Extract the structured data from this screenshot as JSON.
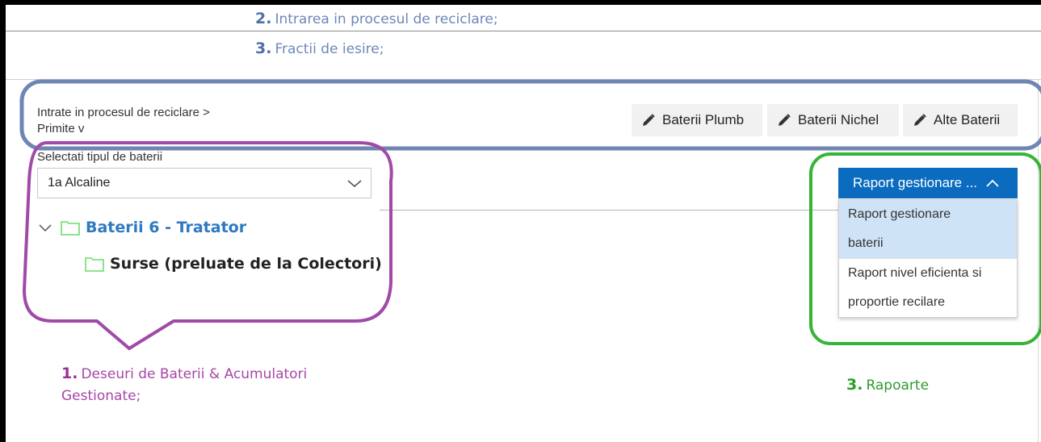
{
  "annotations": {
    "intrare": {
      "num": "2.",
      "text": "Intrarea in procesul de reciclare;"
    },
    "fractii": {
      "num": "3.",
      "text": "Fractii de iesire;"
    },
    "deseuri": {
      "num": "1.",
      "text": "Deseuri de Baterii & Acumulatori Gestionate;"
    },
    "rapoarte": {
      "num": "3.",
      "text": "Rapoarte"
    }
  },
  "breadcrumb": {
    "line1": "Intrate in procesul de reciclare  >",
    "line2": "Primite   v"
  },
  "toolbar": {
    "buttons": [
      {
        "label": "Baterii Plumb"
      },
      {
        "label": "Baterii Nichel"
      },
      {
        "label": "Alte Baterii"
      }
    ]
  },
  "battery_select": {
    "label": "Selectati tipul de baterii",
    "value": "1a Alcaline"
  },
  "tree": {
    "root": "Baterii 6 - Tratator",
    "child": "Surse (preluate de la Colectori)"
  },
  "report_dropdown": {
    "button_label": "Raport gestionare ...",
    "items": [
      {
        "line1": "Raport gestionare",
        "line2": "baterii"
      },
      {
        "line1": "Raport nivel eficienta si",
        "line2": "proportie recilare"
      }
    ]
  },
  "colors": {
    "blue_highlight": "#6f86b5",
    "purple_highlight": "#a04aa8",
    "green_highlight": "#35b535",
    "primary_button": "#0a6bbf",
    "tree_root": "#2e79c0",
    "folder_outline": "#6cdc6c"
  }
}
